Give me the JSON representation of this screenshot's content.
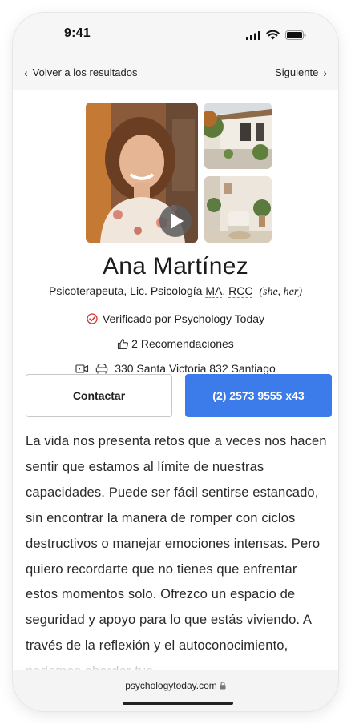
{
  "status": {
    "time": "9:41"
  },
  "nav": {
    "back_label": "Volver a los resultados",
    "next_label": "Siguiente"
  },
  "profile": {
    "name": "Ana Martínez",
    "title": "Psicoterapeuta, Lic. Psicología",
    "cred1": "MA",
    "sep": ",",
    "cred2": "RCC",
    "pronouns": "(she, her)",
    "verified": "Verificado por Psychology Today",
    "recommendations": "2 Recomendaciones",
    "address": "330 Santa Victoria 832 Santiago"
  },
  "actions": {
    "contact_label": "Contactar",
    "phone_label": "(2) 2573 9555 x43"
  },
  "bio": "La vida nos presenta retos que a veces nos hacen sentir que estamos al límite de nuestras capacidades. Puede ser fácil sentirse estancado, sin encontrar la manera de romper con ciclos destructivos o manejar emociones intensas. Pero quiero recordarte que no tienes que enfrentar estos momentos solo. Ofrezco un espacio de seguridad y apoyo para lo que estás viviendo. A través de la reflexión y el autoconocimiento, podemos abordar tus",
  "browser": {
    "url": "psychologytoday.com"
  },
  "colors": {
    "accent": "#3c7bea",
    "verified_red": "#d9302c"
  },
  "icons": [
    "chevron-left-icon",
    "chevron-right-icon",
    "play-icon",
    "verified-check-icon",
    "thumbs-up-icon",
    "video-icon",
    "in-person-icon",
    "lock-icon",
    "signal-icon",
    "wifi-icon",
    "battery-icon"
  ]
}
